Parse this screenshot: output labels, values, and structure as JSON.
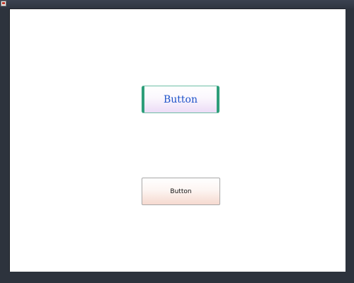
{
  "window": {
    "icon": "app-icon"
  },
  "buttons": {
    "styled_label": "Button",
    "plain_label": "Button"
  },
  "colors": {
    "styled_text": "#1d52c9",
    "styled_border": "#2e9e7a",
    "styled_gradient_bottom": "#ecdcf6",
    "plain_gradient_bottom": "#f5d9cf",
    "frame": "#2c323c",
    "client_background": "#ffffff"
  }
}
